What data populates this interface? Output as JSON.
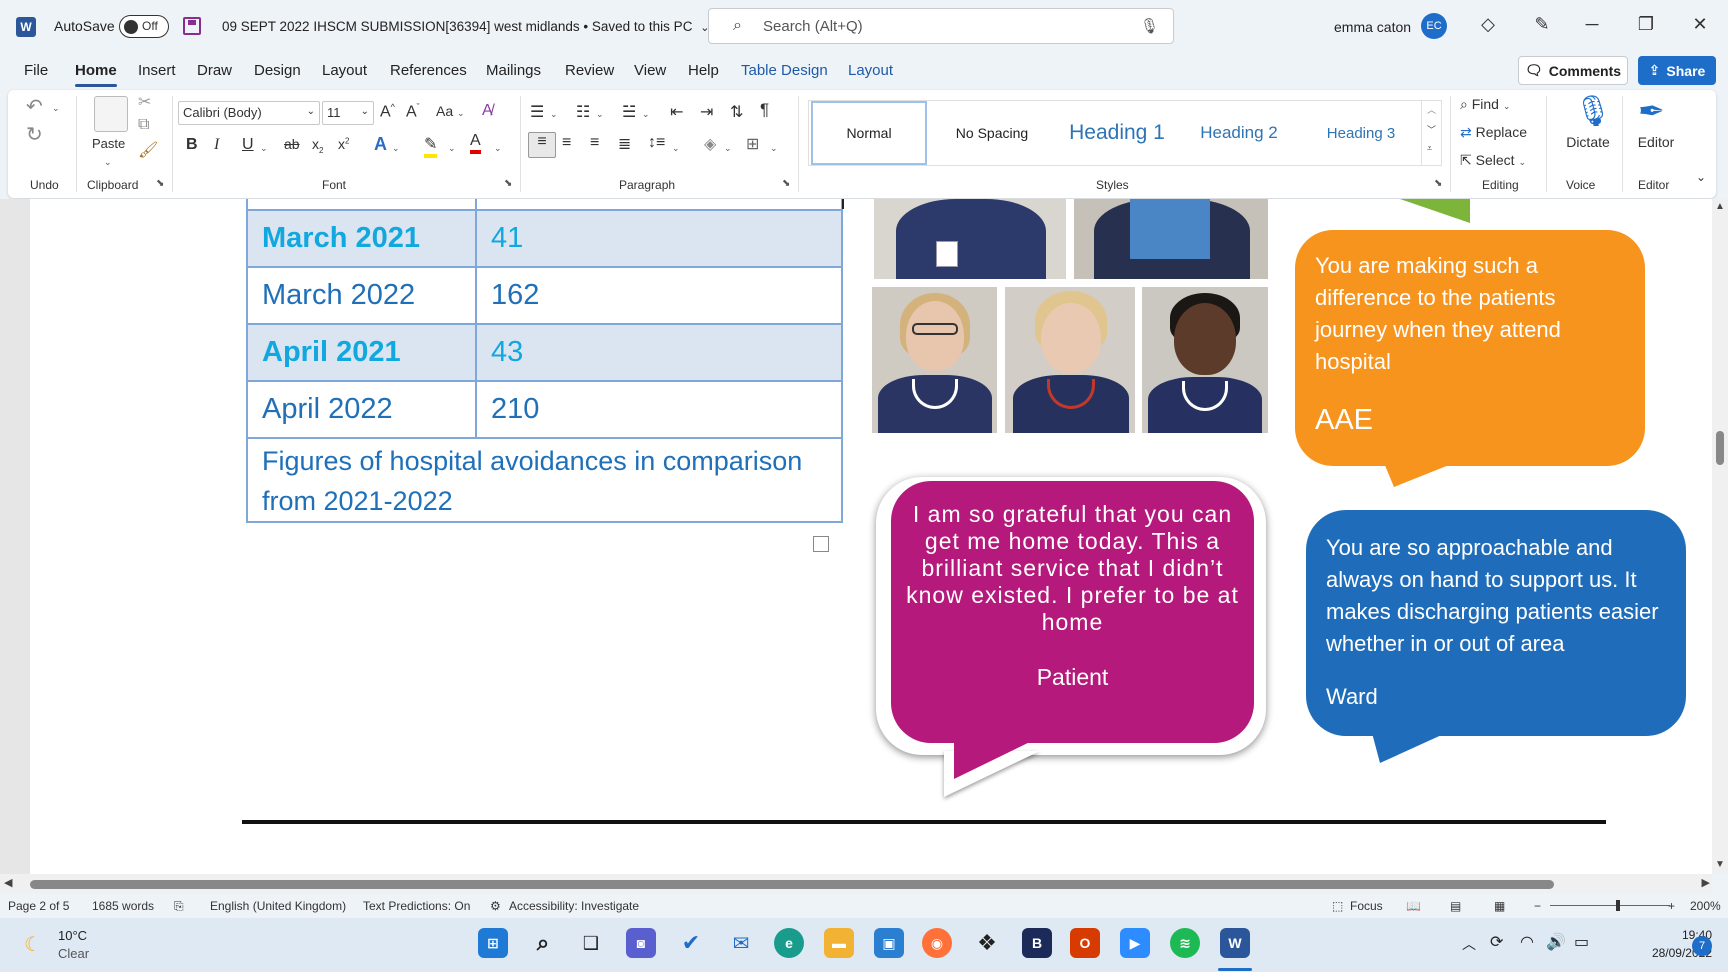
{
  "titlebar": {
    "app_icon": "W",
    "autosave_label": "AutoSave",
    "autosave_state": "Off",
    "document_title": "09 SEPT 2022 IHSCM SUBMISSION[36394] west midlands • Saved to this PC",
    "search_placeholder": "Search (Alt+Q)",
    "user_name": "emma caton",
    "user_initials": "EC"
  },
  "menu": {
    "items": [
      "File",
      "Home",
      "Insert",
      "Draw",
      "Design",
      "Layout",
      "References",
      "Mailings",
      "Review",
      "View",
      "Help",
      "Table Design",
      "Layout"
    ],
    "comments": "Comments",
    "share": "Share"
  },
  "ribbon": {
    "groups": {
      "undo": "Undo",
      "clipboard": "Clipboard",
      "font": "Font",
      "paragraph": "Paragraph",
      "styles": "Styles",
      "editing": "Editing",
      "voice": "Voice",
      "editor": "Editor"
    },
    "paste": "Paste",
    "font_name": "Calibri (Body)",
    "font_size": "11",
    "case_label": "Aa",
    "styles": [
      "Normal",
      "No Spacing",
      "Heading 1",
      "Heading 2",
      "Heading 3"
    ],
    "find": "Find",
    "replace": "Replace",
    "select": "Select",
    "dictate": "Dictate",
    "editor_btn": "Editor"
  },
  "document": {
    "table_rows": [
      {
        "month": "March 2021",
        "value": "41",
        "shaded": true
      },
      {
        "month": "March 2022",
        "value": "162",
        "shaded": false
      },
      {
        "month": "April 2021",
        "value": "43",
        "shaded": true
      },
      {
        "month": "April 2022",
        "value": "210",
        "shaded": false
      }
    ],
    "table_caption": "Figures of hospital avoidances in comparison from 2021-2022",
    "bubble_orange": {
      "text": "You are making such a difference to the patients journey when they attend hospital",
      "signature": "AAE",
      "color": "#f7941d"
    },
    "bubble_magenta": {
      "text": "I am so grateful that you can get me home today. This a brilliant service that I didn’t know existed. I prefer to be at home",
      "signature": "Patient",
      "color": "#b5197b"
    },
    "bubble_blue": {
      "text": "You are so approachable and always on hand to support us. It makes discharging patients easier whether in or out of area",
      "signature": "Ward",
      "color": "#1f6dba"
    }
  },
  "statusbar": {
    "page": "Page 2 of 5",
    "words": "1685 words",
    "language": "English (United Kingdom)",
    "predictions": "Text Predictions: On",
    "accessibility": "Accessibility: Investigate",
    "focus": "Focus",
    "zoom": "200%"
  },
  "taskbar": {
    "weather_temp": "10°C",
    "weather_desc": "Clear",
    "time": "19:40",
    "date": "28/09/2022",
    "notifications": "7"
  }
}
